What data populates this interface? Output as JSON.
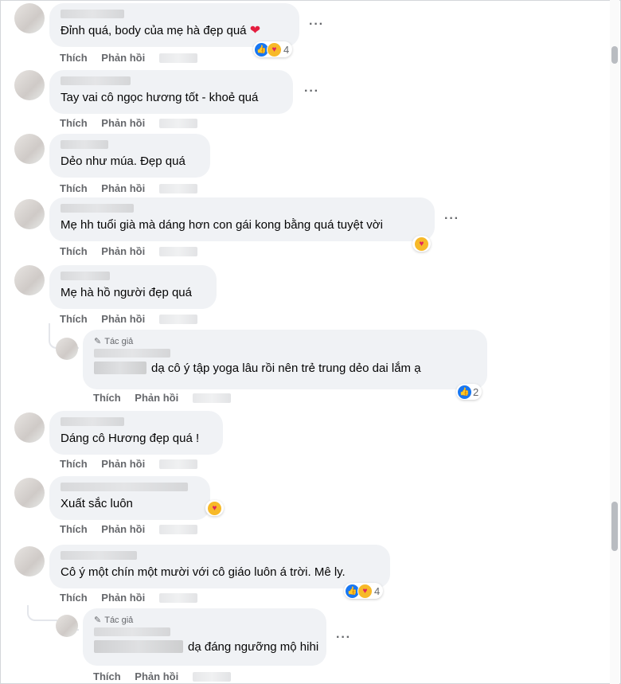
{
  "comments": [
    {
      "text": "Đỉnh quá, body của mẹ hà đẹp quá",
      "like": "Thích",
      "reply": "Phản hồi",
      "reactions": "4"
    },
    {
      "text": "Tay vai cô ngọc hương tốt - khoẻ quá",
      "like": "Thích",
      "reply": "Phản hồi"
    },
    {
      "text": "Dẻo như múa. Đẹp quá",
      "like": "Thích",
      "reply": "Phản hồi"
    },
    {
      "text": "Mẹ hh tuổi già mà dáng hơn con gái kong bằng quá tuyệt vời",
      "like": "Thích",
      "reply": "Phản hồi"
    },
    {
      "text": "Mẹ hà hồ người đẹp quá",
      "like": "Thích",
      "reply": "Phản hồi"
    },
    {
      "text": "dạ cô ý tập yoga lâu rồi nên trẻ trung dẻo dai lắm ạ",
      "author_badge": "Tác giả",
      "like": "Thích",
      "reply": "Phản hồi",
      "reactions": "2"
    },
    {
      "text": "Dáng cô Hương đẹp quá !",
      "like": "Thích",
      "reply": "Phản hồi"
    },
    {
      "text": "Xuất sắc luôn",
      "like": "Thích",
      "reply": "Phản hồi"
    },
    {
      "text": "Cô ý một chín một mười với cô giáo luôn á trời. Mê ly.",
      "like": "Thích",
      "reply": "Phản hồi",
      "reactions": "4"
    },
    {
      "text": "dạ đáng ngưỡng mộ hihi",
      "author_badge": "Tác giả",
      "like": "Thích",
      "reply": "Phản hồi"
    }
  ],
  "icons": {
    "more": "more-options-icon",
    "like": "like-reaction-icon",
    "care": "care-reaction-icon",
    "heart": "red-heart-emoji",
    "pencil": "pencil-icon"
  },
  "colors": {
    "bubble": "#f0f2f5",
    "like_blue": "#1877f2",
    "action_gray": "#65676b"
  }
}
